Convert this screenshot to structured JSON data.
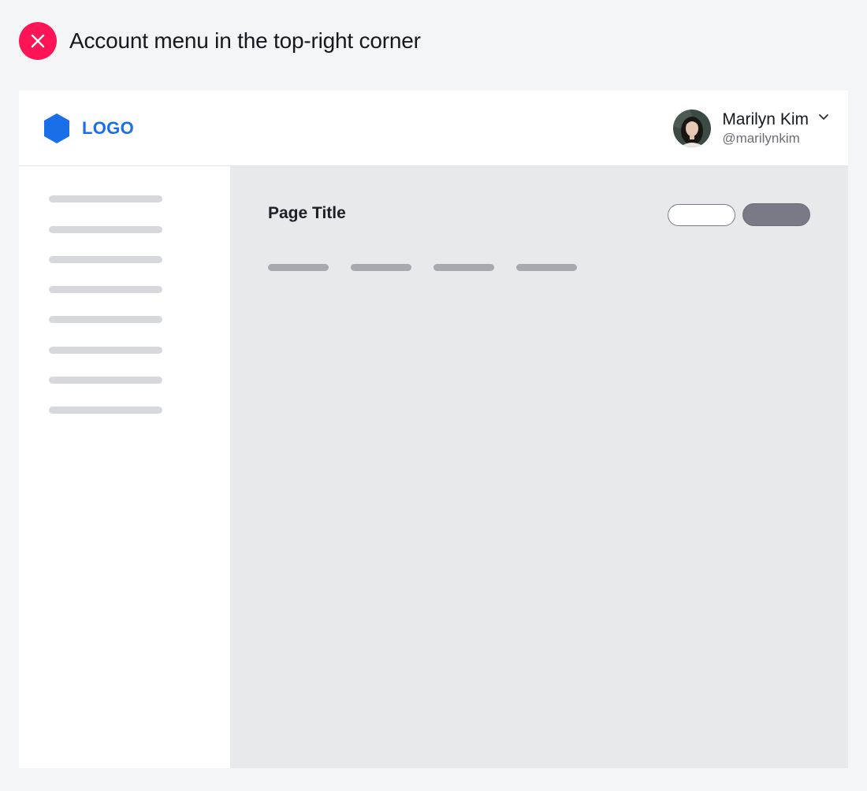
{
  "heading": {
    "text": "Account menu in the top-right corner",
    "icon": "close-icon",
    "badge_color": "#ff1455"
  },
  "app": {
    "logo": {
      "text": "LOGO",
      "icon": "hexagon-icon",
      "color": "#1a6ee8"
    },
    "account": {
      "name": "Marilyn Kim",
      "handle": "@marilynkim",
      "dropdown_icon": "chevron-down-icon"
    },
    "sidebar": {
      "items": [
        "",
        "",
        "",
        "",
        "",
        "",
        "",
        ""
      ]
    },
    "main": {
      "page_title": "Page Title",
      "actions": [
        {
          "label": "",
          "style": "outline"
        },
        {
          "label": "",
          "style": "filled"
        }
      ],
      "tabs": [
        "",
        "",
        "",
        ""
      ]
    }
  }
}
